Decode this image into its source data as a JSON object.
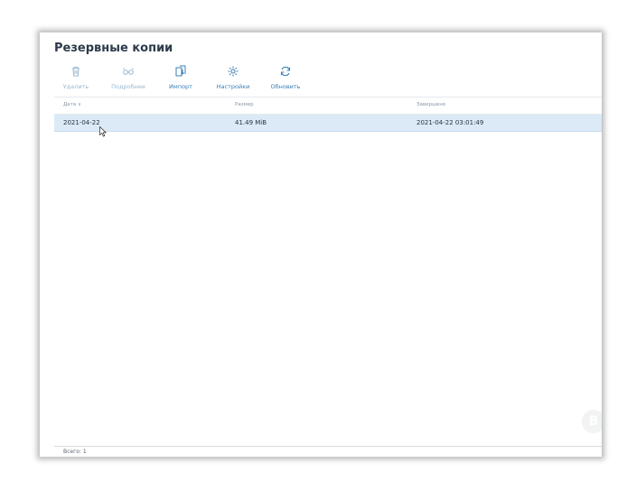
{
  "page": {
    "title": "Резервные копии"
  },
  "toolbar": {
    "items": [
      {
        "label": "Удалить",
        "icon": "trash-icon",
        "enabled": false
      },
      {
        "label": "Подробнее",
        "icon": "glasses-icon",
        "enabled": false
      },
      {
        "label": "Импорт",
        "icon": "import-icon",
        "enabled": true
      },
      {
        "label": "Настройки",
        "icon": "gear-icon",
        "enabled": true
      },
      {
        "label": "Обновить",
        "icon": "refresh-icon",
        "enabled": true
      }
    ]
  },
  "table": {
    "columns": [
      "Дата ∨",
      "Размер",
      "Завершено"
    ],
    "rows": [
      {
        "date": "2021-04-22",
        "size": "41.49 MiB",
        "completed": "2021-04-22 03:01:49"
      }
    ]
  },
  "footer": {
    "total": "Всего: 1"
  },
  "colors": {
    "accent": "#3a7fb5",
    "selected_row": "#dbeaf6"
  }
}
